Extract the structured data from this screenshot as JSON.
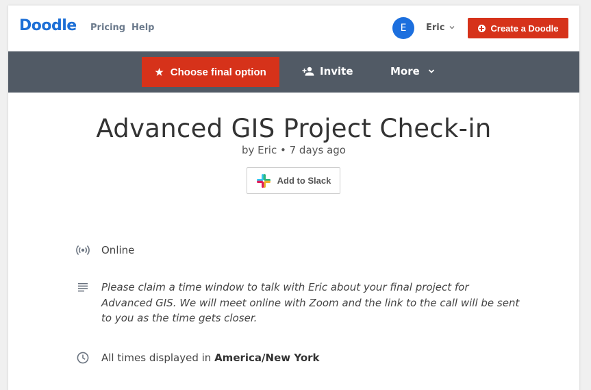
{
  "header": {
    "logo": "Doodle",
    "nav": [
      "Pricing",
      "Help"
    ],
    "avatar_initial": "E",
    "user_name": "Eric",
    "create_label": "Create a Doodle"
  },
  "toolbar": {
    "choose_label": "Choose final option",
    "invite_label": "Invite",
    "more_label": "More"
  },
  "poll": {
    "title": "Advanced GIS Project Check-in",
    "byline": "by Eric • 7 days ago",
    "slack_label": "Add to Slack",
    "location": "Online",
    "description": "Please claim a time window to talk with Eric about your final project for Advanced GIS. We will meet online with Zoom and the link to the call will be sent to you as the time gets closer.",
    "timezone_prefix": "All times displayed in",
    "timezone": "America/New York"
  },
  "colors": {
    "brand": "#1d6fd6",
    "accent": "#d6321a",
    "toolbar": "#515a65"
  }
}
